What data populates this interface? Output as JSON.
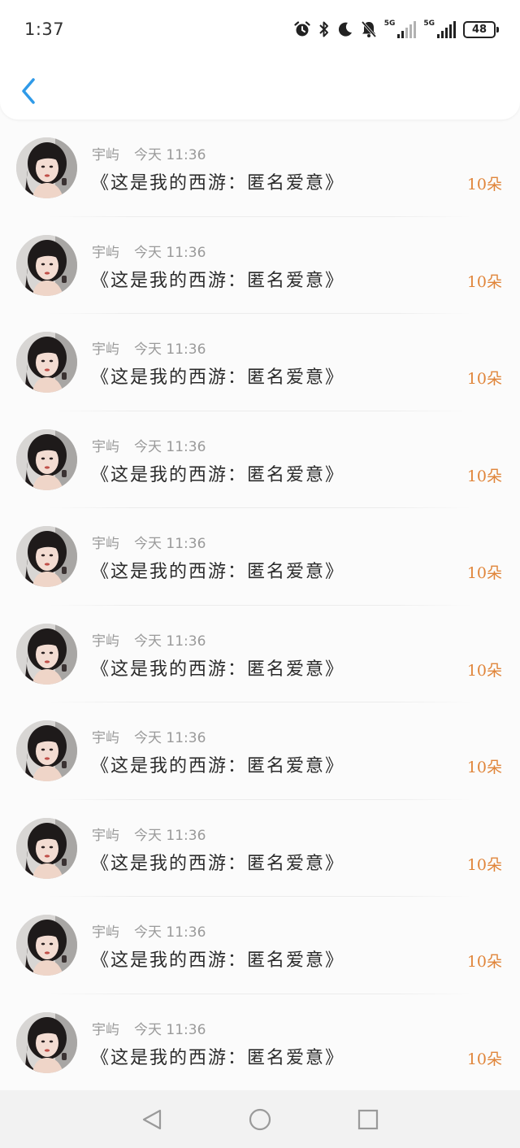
{
  "status_bar": {
    "time": "1:37",
    "icons": [
      "alarm-icon",
      "bluetooth-icon",
      "moon-icon",
      "bell-off-icon"
    ],
    "network_1": "5G",
    "network_2": "5G",
    "battery": "48"
  },
  "nav": {
    "back_icon": "chevron-left-icon",
    "accent": "#2f9ae8"
  },
  "colors": {
    "count": "#e0853a",
    "meta": "#9a9a9a",
    "title": "#2b2b2b"
  },
  "items": [
    {
      "name": "宇屿",
      "time": "今天 11:36",
      "title": "《这是我的西游：匿名爱意》",
      "count": "10朵"
    },
    {
      "name": "宇屿",
      "time": "今天 11:36",
      "title": "《这是我的西游：匿名爱意》",
      "count": "10朵"
    },
    {
      "name": "宇屿",
      "time": "今天 11:36",
      "title": "《这是我的西游：匿名爱意》",
      "count": "10朵"
    },
    {
      "name": "宇屿",
      "time": "今天 11:36",
      "title": "《这是我的西游：匿名爱意》",
      "count": "10朵"
    },
    {
      "name": "宇屿",
      "time": "今天 11:36",
      "title": "《这是我的西游：匿名爱意》",
      "count": "10朵"
    },
    {
      "name": "宇屿",
      "time": "今天 11:36",
      "title": "《这是我的西游：匿名爱意》",
      "count": "10朵"
    },
    {
      "name": "宇屿",
      "time": "今天 11:36",
      "title": "《这是我的西游：匿名爱意》",
      "count": "10朵"
    },
    {
      "name": "宇屿",
      "time": "今天 11:36",
      "title": "《这是我的西游：匿名爱意》",
      "count": "10朵"
    },
    {
      "name": "宇屿",
      "time": "今天 11:36",
      "title": "《这是我的西游：匿名爱意》",
      "count": "10朵"
    },
    {
      "name": "宇屿",
      "time": "今天 11:36",
      "title": "《这是我的西游：匿名爱意》",
      "count": "10朵"
    }
  ],
  "bottom_nav": [
    "back-triangle-icon",
    "home-circle-icon",
    "recents-square-icon"
  ]
}
